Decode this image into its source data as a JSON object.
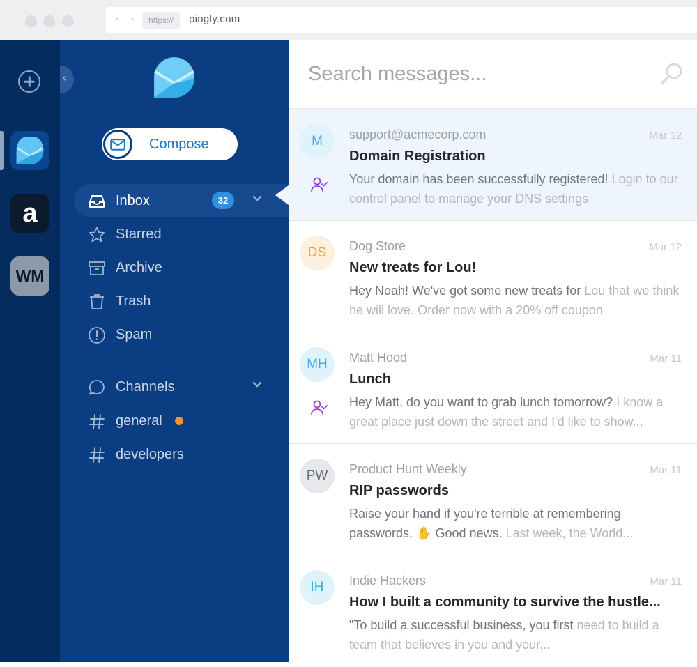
{
  "browser": {
    "nav_arrows": "‹ ›",
    "protocol": "https://",
    "domain": "pingly.com"
  },
  "accounts": [
    {
      "name": "pingly",
      "icon": "pingly-logo-icon",
      "active": true
    },
    {
      "name": "a",
      "label": "a"
    },
    {
      "name": "wm",
      "label": "WM"
    }
  ],
  "sidebar": {
    "compose_label": "Compose",
    "nav": [
      {
        "label": "Inbox",
        "icon": "inbox-icon",
        "badge": "32",
        "active": true
      },
      {
        "label": "Starred",
        "icon": "star-icon"
      },
      {
        "label": "Archive",
        "icon": "archive-icon"
      },
      {
        "label": "Trash",
        "icon": "trash-icon"
      },
      {
        "label": "Spam",
        "icon": "spam-icon"
      }
    ],
    "channels_label": "Channels",
    "channels": [
      {
        "label": "general",
        "unread": true
      },
      {
        "label": "developers",
        "unread": false
      }
    ]
  },
  "search": {
    "placeholder": "Search messages..."
  },
  "colors": {
    "rail": "#052c5e",
    "sidebar": "#0b3d82",
    "accent": "#2f8fe0",
    "unread_dot": "#f0962b"
  },
  "messages": [
    {
      "initials": "M",
      "sender": "support@acmecorp.com",
      "date": "Mar 12",
      "subject": "Domain Registration",
      "preview_main": "Your domain has been successfully registered!",
      "preview_rest": " Login to our control panel to manage your DNS settings",
      "assigned": true,
      "selected": true
    },
    {
      "initials": "DS",
      "sender": "Dog Store",
      "date": "Mar 12",
      "subject": "New treats for Lou!",
      "preview_main": "Hey Noah! We've got some new treats for",
      "preview_rest": " Lou that we think he will love. Order now with a 20% off coupon",
      "assigned": false
    },
    {
      "initials": "MH",
      "sender": "Matt Hood",
      "date": "Mar 11",
      "subject": "Lunch",
      "preview_main": "Hey Matt, do you want to grab lunch tomorrow?",
      "preview_rest": " I know a great place just down the street and I'd like to show...",
      "assigned": true
    },
    {
      "initials": "PW",
      "sender": "Product Hunt Weekly",
      "date": "Mar 11",
      "subject": "RIP passwords",
      "preview_main": "Raise your hand if you're terrible at remembering passwords. ✋ Good news.",
      "preview_rest": " Last week, the World...",
      "assigned": false
    },
    {
      "initials": "IH",
      "sender": "Indie Hackers",
      "date": "Mar 11",
      "subject": "How I built a community to survive the hustle...",
      "preview_main": "\"To build a successful business, you first",
      "preview_rest": " need to build a team that believes in you and your...",
      "assigned": false
    }
  ]
}
